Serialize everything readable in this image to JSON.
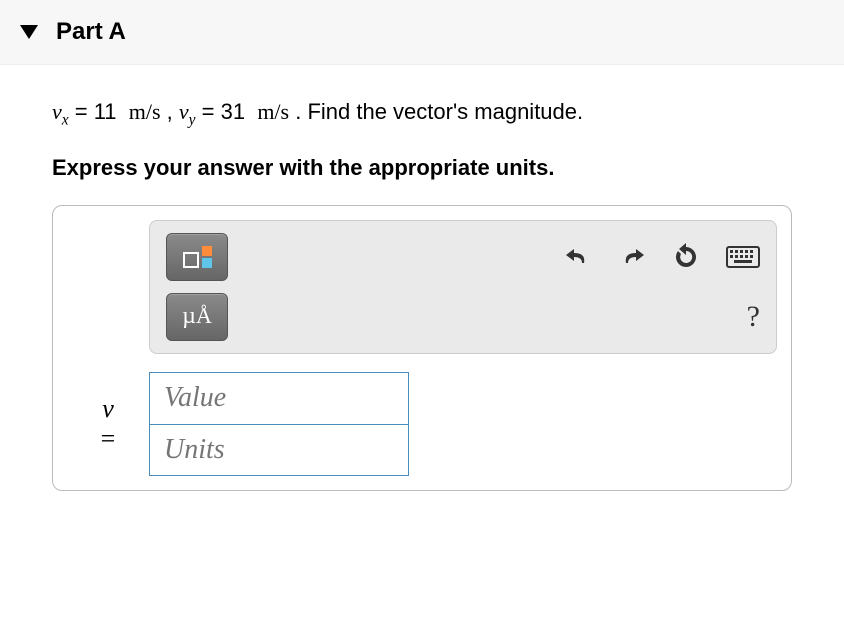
{
  "header": {
    "title": "Part A"
  },
  "problem": {
    "vx_var": "v",
    "vx_sub": "x",
    "vx_val": "11",
    "vy_var": "v",
    "vy_sub": "y",
    "vy_val": "31",
    "unit": "m/s",
    "question": "Find the vector's magnitude.",
    "instruction": "Express your answer with the appropriate units."
  },
  "toolbar": {
    "templates_label": "templates",
    "mu_a": "µÅ",
    "undo": "undo",
    "redo": "redo",
    "reset": "reset",
    "keyboard": "keyboard",
    "help": "?"
  },
  "answer": {
    "variable": "v",
    "equals": "=",
    "value_placeholder": "Value",
    "units_placeholder": "Units"
  }
}
